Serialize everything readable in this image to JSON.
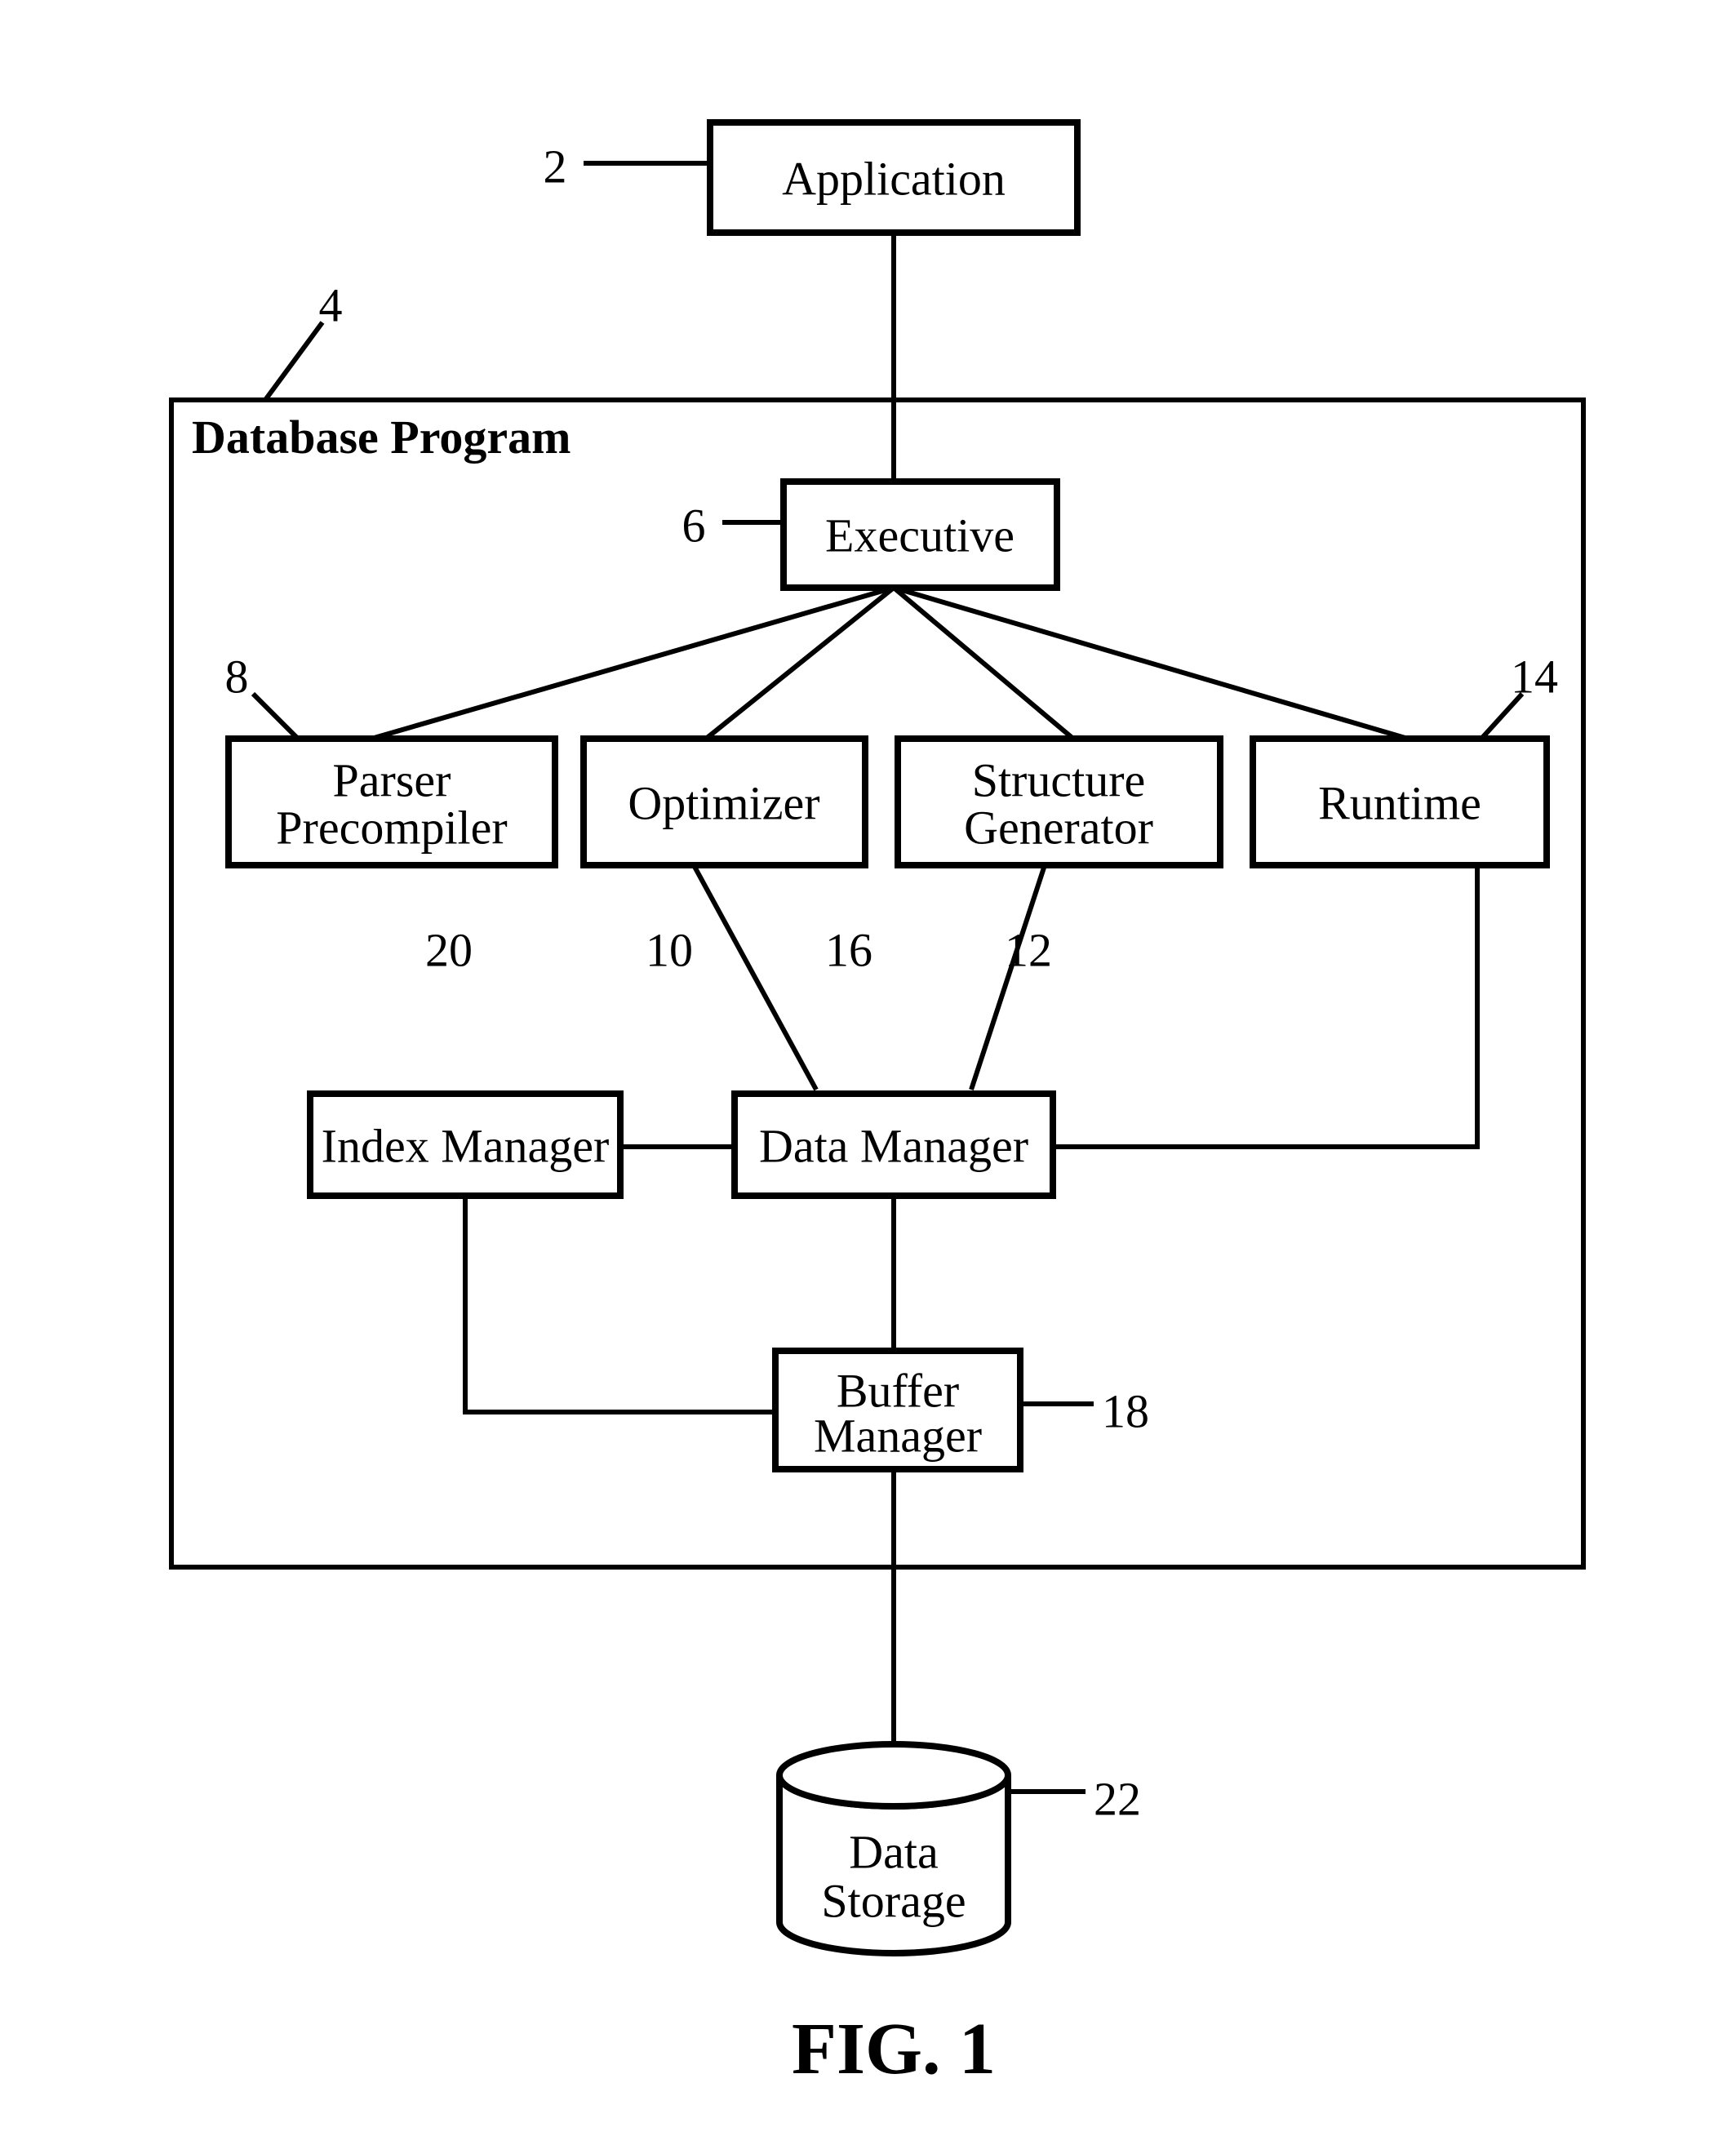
{
  "figure_caption": "FIG. 1",
  "container": {
    "title": "Database Program",
    "ref": "4"
  },
  "nodes": {
    "application": {
      "label": "Application",
      "ref": "2"
    },
    "executive": {
      "label": "Executive",
      "ref": "6"
    },
    "parser_precompiler": {
      "label1": "Parser",
      "label2": "Precompiler",
      "ref": "8"
    },
    "optimizer": {
      "label": "Optimizer",
      "ref": "10"
    },
    "structure_generator": {
      "label1": "Structure",
      "label2": "Generator",
      "ref": "12"
    },
    "runtime": {
      "label": "Runtime",
      "ref": "14"
    },
    "data_manager": {
      "label": "Data Manager",
      "ref": "16"
    },
    "buffer_manager": {
      "label1": "Buffer",
      "label2": "Manager",
      "ref": "18"
    },
    "index_manager": {
      "label": "Index Manager",
      "ref": "20"
    },
    "data_storage": {
      "label1": "Data",
      "label2": "Storage",
      "ref": "22"
    }
  },
  "edges": [
    [
      "application",
      "executive"
    ],
    [
      "executive",
      "parser_precompiler"
    ],
    [
      "executive",
      "optimizer"
    ],
    [
      "executive",
      "structure_generator"
    ],
    [
      "executive",
      "runtime"
    ],
    [
      "optimizer",
      "data_manager"
    ],
    [
      "structure_generator",
      "data_manager"
    ],
    [
      "runtime",
      "data_manager"
    ],
    [
      "index_manager",
      "data_manager"
    ],
    [
      "data_manager",
      "buffer_manager"
    ],
    [
      "index_manager",
      "buffer_manager"
    ],
    [
      "buffer_manager",
      "data_storage"
    ]
  ]
}
